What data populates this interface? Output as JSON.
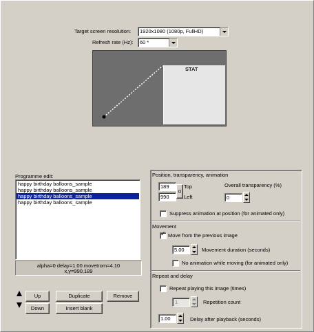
{
  "resolution": {
    "label": "Target screen resolution:",
    "value": "1920x1080 (1080p, FullHD)"
  },
  "refresh": {
    "label": "Refresh rate (Hz):",
    "value": "60 *"
  },
  "preview": {
    "stat_label": "STAT"
  },
  "programme": {
    "title": "Programme edit:",
    "items": [
      "happy birthday balloons_sample",
      "happy birthday balloons_sample",
      "happy birthday balloons_sample",
      "happy birthday balloons_sample"
    ],
    "selected_index": 2,
    "status_line1": "alpha=0  delay=1.00  movetrom=4.10",
    "status_line2": "x,y=990,189"
  },
  "buttons": {
    "up": "Up",
    "down": "Down",
    "duplicate": "Duplicate",
    "remove": "Remove",
    "insert_blank": "Insert blank"
  },
  "position": {
    "title": "Position, transparency, animation",
    "top_value": "189",
    "top_label": "Top",
    "left_value": "990",
    "left_label": "Left",
    "zero_button": "0",
    "transparency_label": "Overall transparency (%)",
    "transparency_value": "0",
    "suppress_label": "Suppress animation at position (for animated only)"
  },
  "movement": {
    "title": "Movement",
    "move_from_label": "Move from the previous image",
    "duration_value": "5.00",
    "duration_label": "Movement duration (seconds)",
    "no_anim_label": "No animation while moving (for animated only)"
  },
  "repeat": {
    "title": "Repeat and delay",
    "repeat_label": "Repeat playing this image (times)",
    "count_value": "1",
    "count_label": "Repetition count",
    "delay_value": "1.00",
    "delay_label": "Delay after playback (seconds)"
  },
  "colors": {
    "selection": "#0a24a0",
    "face": "#d4d0c8",
    "preview_bg": "#6e6e6e"
  }
}
